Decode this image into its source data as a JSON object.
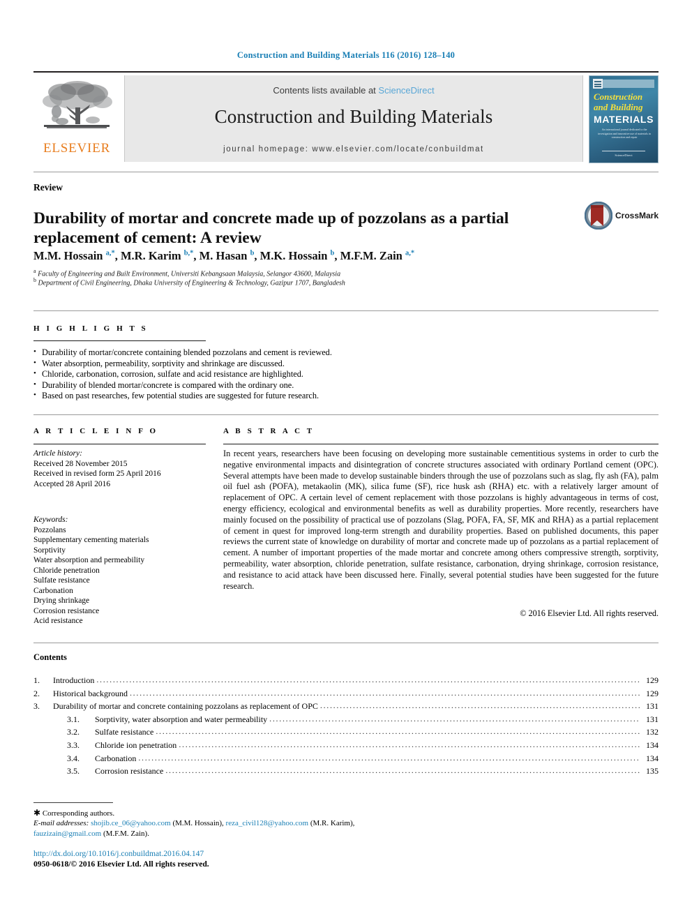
{
  "running_head": "Construction and Building Materials 116 (2016) 128–140",
  "masthead": {
    "contents_prefix": "Contents lists available at ",
    "sciencedirect": "ScienceDirect",
    "journal_title": "Construction and Building Materials",
    "homepage": "journal homepage: www.elsevier.com/locate/conbuildmat",
    "publisher_wordmark": "ELSEVIER",
    "publisher_logo_icon": "elsevier-tree-icon",
    "cover": {
      "line1": "Construction",
      "line2": "and Building",
      "line3": "MATERIALS",
      "subtitle": "An international journal dedicated to the investigation and innovative use of materials in construction and repair",
      "footer": "ScienceDirect",
      "logo_icon": "elsevier-mark-icon"
    },
    "accent_link_color": "#5aa7d6",
    "brand_orange": "#e87d1e"
  },
  "article": {
    "type": "Review",
    "title": "Durability of mortar and concrete made up of pozzolans as a partial replacement of cement: A review",
    "crossmark_label": "CrossMark",
    "crossmark_icon": "crossmark-badge-icon",
    "authors_html": "M.M. Hossain <sup>a,*</sup>, M.R. Karim <sup>b,*</sup>, M. Hasan <sup>b</sup>, M.K. Hossain <sup>b</sup>, M.F.M. Zain <sup>a,*</sup>",
    "affiliation_a": "Faculty of Engineering and Built Environment, Universiti Kebangsaan Malaysia, Selangor 43600, Malaysia",
    "affiliation_b": "Department of Civil Engineering, Dhaka University of Engineering & Technology, Gazipur 1707, Bangladesh"
  },
  "highlights": {
    "label": "H I G H L I G H T S",
    "items": [
      "Durability of mortar/concrete containing blended pozzolans and cement is reviewed.",
      "Water absorption, permeability, sorptivity and shrinkage are discussed.",
      "Chloride, carbonation, corrosion, sulfate and acid resistance are highlighted.",
      "Durability of blended mortar/concrete is compared with the ordinary one.",
      "Based on past researches, few potential studies are suggested for future research."
    ]
  },
  "article_info": {
    "label": "A R T I C L E   I N F O",
    "history_heading": "Article history:",
    "history": [
      "Received 28 November 2015",
      "Received in revised form 25 April 2016",
      "Accepted 28 April 2016"
    ],
    "keywords_heading": "Keywords:",
    "keywords": [
      "Pozzolans",
      "Supplementary cementing materials",
      "Sorptivity",
      "Water absorption and permeability",
      "Chloride penetration",
      "Sulfate resistance",
      "Carbonation",
      "Drying shrinkage",
      "Corrosion resistance",
      "Acid resistance"
    ]
  },
  "abstract": {
    "label": "A B S T R A C T",
    "text": "In recent years, researchers have been focusing on developing more sustainable cementitious systems in order to curb the negative environmental impacts and disintegration of concrete structures associated with ordinary Portland cement (OPC). Several attempts have been made to develop sustainable binders through the use of pozzolans such as slag, fly ash (FA), palm oil fuel ash (POFA), metakaolin (MK), silica fume (SF), rice husk ash (RHA) etc. with a relatively larger amount of replacement of OPC. A certain level of cement replacement with those pozzolans is highly advantageous in terms of cost, energy efficiency, ecological and environmental benefits as well as durability properties. More recently, researchers have mainly focused on the possibility of practical use of pozzolans (Slag, POFA, FA, SF, MK and RHA) as a partial replacement of cement in quest for improved long-term strength and durability properties. Based on published documents, this paper reviews the current state of knowledge on durability of mortar and concrete made up of pozzolans as a partial replacement of cement. A number of important properties of the made mortar and concrete among others compressive strength, sorptivity, permeability, water absorption, chloride penetration, sulfate resistance, carbonation, drying shrinkage, corrosion resistance, and resistance to acid attack have been discussed here. Finally, several potential studies have been suggested for the future research.",
    "copyright": "© 2016 Elsevier Ltd. All rights reserved."
  },
  "contents": {
    "heading": "Contents",
    "entries": [
      {
        "num": "1.",
        "title": "Introduction",
        "page": "129",
        "sub": false
      },
      {
        "num": "2.",
        "title": "Historical background",
        "page": "129",
        "sub": false
      },
      {
        "num": "3.",
        "title": "Durability of mortar and concrete containing pozzolans as replacement of OPC",
        "page": "131",
        "sub": false
      },
      {
        "num": "3.1.",
        "title": "Sorptivity, water absorption and water permeability",
        "page": "131",
        "sub": true
      },
      {
        "num": "3.2.",
        "title": "Sulfate resistance",
        "page": "132",
        "sub": true
      },
      {
        "num": "3.3.",
        "title": "Chloride ion penetration",
        "page": "134",
        "sub": true
      },
      {
        "num": "3.4.",
        "title": "Carbonation",
        "page": "134",
        "sub": true
      },
      {
        "num": "3.5.",
        "title": "Corrosion resistance",
        "page": "135",
        "sub": true
      }
    ]
  },
  "footer": {
    "corresponding": "Corresponding authors.",
    "email_label": "E-mail addresses:",
    "emails": [
      {
        "address": "shojib.ce_06@yahoo.com",
        "owner": "(M.M. Hossain)"
      },
      {
        "address": "reza_civil128@yahoo.com",
        "owner": "(M.R. Karim)"
      },
      {
        "address": "fauzizain@gmail.com",
        "owner": "(M.F.M. Zain)"
      }
    ],
    "doi": "http://dx.doi.org/10.1016/j.conbuildmat.2016.04.147",
    "issn_line": "0950-0618/© 2016 Elsevier Ltd. All rights reserved."
  }
}
